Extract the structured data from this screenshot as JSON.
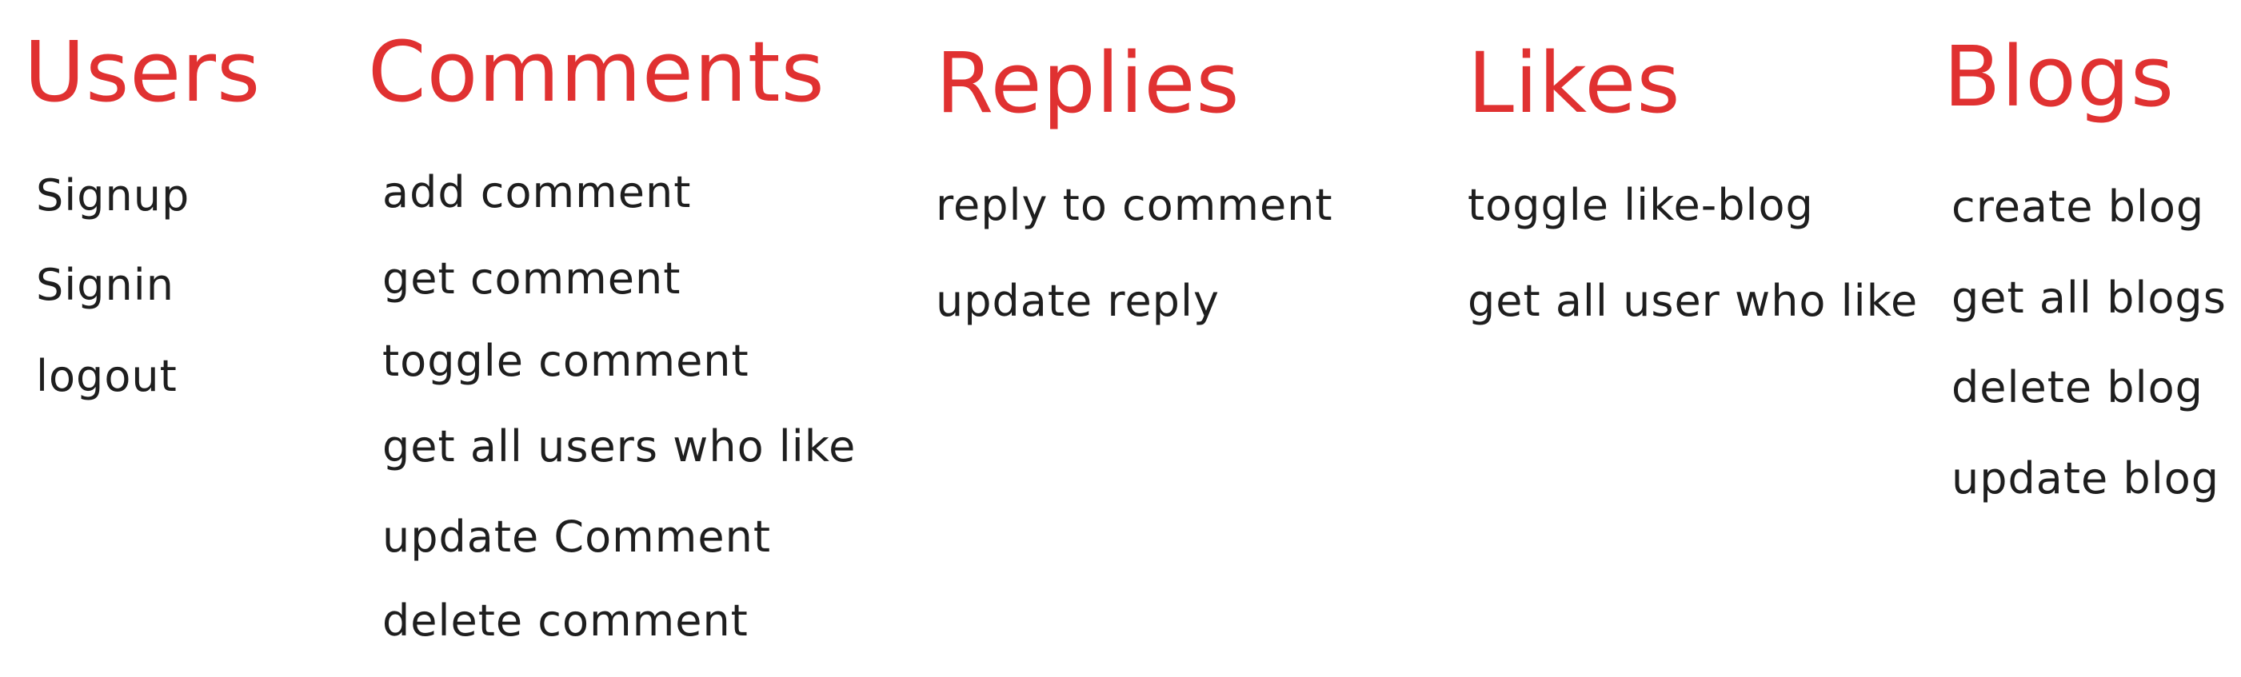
{
  "colors": {
    "title": "#e03131",
    "text": "#1e1e1e",
    "background": "#ffffff"
  },
  "columns": [
    {
      "title": "Users",
      "items": [
        "Signup",
        "Signin",
        "logout"
      ]
    },
    {
      "title": "Comments",
      "items": [
        "add comment",
        "get comment",
        "toggle comment",
        "get all users who like",
        "update Comment",
        "delete comment"
      ]
    },
    {
      "title": "Replies",
      "items": [
        "reply to comment",
        "update reply"
      ]
    },
    {
      "title": "Likes",
      "items": [
        "toggle like-blog",
        "get all user who like"
      ]
    },
    {
      "title": "Blogs",
      "items": [
        "create blog",
        "get all blogs",
        "delete blog",
        "update blog"
      ]
    }
  ]
}
